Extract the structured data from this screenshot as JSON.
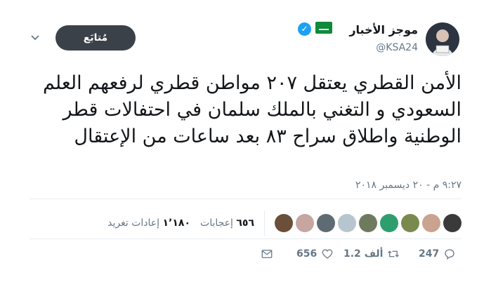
{
  "account": {
    "name": "موجز الأخبار",
    "handle": "@KSA24",
    "verified": true
  },
  "follow_button": {
    "label": "مُتابَع"
  },
  "tweet": {
    "text": "الأمن القطري يعتقل ٢٠٧ مواطن قطري لرفعهم العلم السعودي و التغني بالملك سلمان في احتفالات قطر الوطنية واطلاق سراح ٨٣ بعد ساعات من الإعتقال",
    "timestamp": "٩:٢٧ م - ٢٠ ديسمبر ٢٠١٨"
  },
  "stats": {
    "retweets_count": "١٬١٨٠",
    "retweets_label": "إعادات تغريد",
    "likes_count": "٦٥٦",
    "likes_label": "إعجابات",
    "liker_avatars": [
      "#6b4f3a",
      "#c7a6a0",
      "#5f6b73",
      "#b7c5cf",
      "#6d7a5e",
      "#2f9e6e",
      "#7a8a4e",
      "#c9a38f",
      "#3a3a3a"
    ]
  },
  "actions": {
    "replies": "247",
    "retweets": "1.2 ألف",
    "likes": "656"
  },
  "icons": {
    "reply": "reply-icon",
    "retweet": "retweet-icon",
    "like": "heart-icon",
    "message": "envelope-icon",
    "caret": "chevron-down-icon",
    "verified": "verified-badge-icon"
  }
}
